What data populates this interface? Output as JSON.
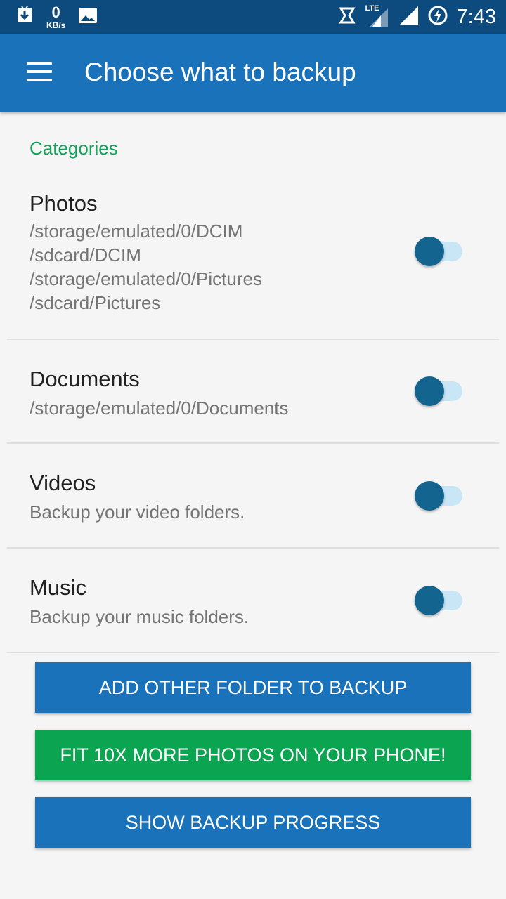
{
  "status_bar": {
    "speed_value": "0",
    "speed_unit": "KB/s",
    "network": "LTE",
    "time": "7:43"
  },
  "app_bar": {
    "title": "Choose what to backup"
  },
  "section": {
    "header": "Categories"
  },
  "categories": [
    {
      "title": "Photos",
      "subtitle": "/storage/emulated/0/DCIM\n/sdcard/DCIM\n/storage/emulated/0/Pictures\n/sdcard/Pictures",
      "enabled": false
    },
    {
      "title": "Documents",
      "subtitle": "/storage/emulated/0/Documents",
      "enabled": false
    },
    {
      "title": "Videos",
      "subtitle": "Backup your video folders.",
      "enabled": false
    },
    {
      "title": "Music",
      "subtitle": "Backup your music folders.",
      "enabled": false
    }
  ],
  "buttons": {
    "add_folder": "ADD OTHER FOLDER TO BACKUP",
    "fit_more": "FIT 10X MORE PHOTOS ON YOUR PHONE!",
    "show_progress": "SHOW BACKUP PROGRESS"
  },
  "colors": {
    "status_bar": "#0d4a7e",
    "app_bar": "#1a72bb",
    "accent_green": "#0ba450",
    "toggle_thumb": "#13658f",
    "toggle_track": "#c9e6f7"
  }
}
